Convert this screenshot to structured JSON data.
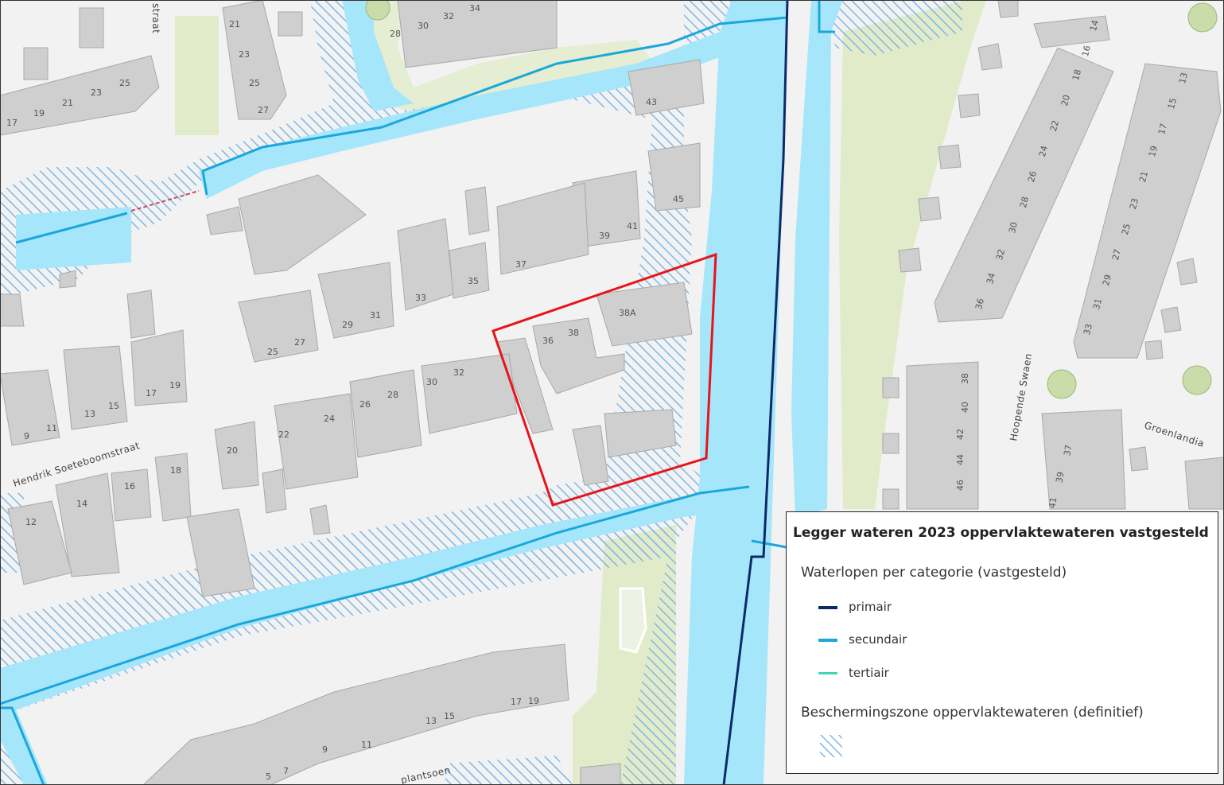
{
  "map": {
    "colors": {
      "background": "#f2f2f2",
      "water": "#a6e6fa",
      "green": "#e1ebc9",
      "building": "#cfcfcf",
      "primair": "#0c2a6b",
      "secundair": "#1aa7dc",
      "tertiair": "#3fd6b5",
      "hatch": "#7fb8e6",
      "selection": "#e8141a"
    },
    "streets": {
      "hendrik": "Hendrik Soeteboomstraat",
      "hoopende": "Hoopende Swaen",
      "groenlandia": "Groenlandia",
      "plantsoen": "plantsoen",
      "straat": "straat"
    },
    "house_numbers": {
      "n17a": "17",
      "n19a": "19",
      "n21a": "21",
      "n23a": "23",
      "n25a": "25",
      "n21b": "21",
      "n23b": "23",
      "n25b": "25",
      "n27b": "27",
      "n28t": "28",
      "n30t": "30",
      "n32t": "32",
      "n34t": "34",
      "n43": "43",
      "n45": "45",
      "n39": "39",
      "n41": "41",
      "n37": "37",
      "n35": "35",
      "n33": "33",
      "n29": "29",
      "n31": "31",
      "n25c": "25",
      "n27c": "27",
      "n36": "36",
      "n38": "38",
      "n38a": "38A",
      "n30m": "30",
      "n32m": "32",
      "n26": "26",
      "n28m": "28",
      "n24": "24",
      "n22": "22",
      "n20": "20",
      "n18": "18",
      "n16": "16",
      "n14": "14",
      "n12": "12",
      "n9": "9",
      "n11": "11",
      "n13": "13",
      "n15": "15",
      "n17b": "17",
      "n19b": "19",
      "n5": "5",
      "n7": "7",
      "n9b": "9",
      "n11b": "11",
      "n13b": "13",
      "n15b": "15",
      "n17c": "17",
      "n19c": "19",
      "e14": "14",
      "e16": "16",
      "e18": "18",
      "e20": "20",
      "e22": "22",
      "e24": "24",
      "e26": "26",
      "e28": "28",
      "e30": "30",
      "e32": "32",
      "e34": "34",
      "e36": "36",
      "e13": "13",
      "e15": "15",
      "e17": "17",
      "e19": "19",
      "e21": "21",
      "e23": "23",
      "e25": "25",
      "e27": "27",
      "e29": "29",
      "e31": "31",
      "e33": "33",
      "s38": "38",
      "s40": "40",
      "s42": "42",
      "s44": "44",
      "s46": "46",
      "s37": "37",
      "s39": "39",
      "s41": "41"
    }
  },
  "legend": {
    "title": "Legger wateren 2023 oppervlaktewateren vastgesteld",
    "category_header": "Waterlopen per categorie (vastgesteld)",
    "items": [
      {
        "label": "primair",
        "color": "#0c2a6b"
      },
      {
        "label": "secundair",
        "color": "#1aa7dc"
      },
      {
        "label": "tertiair",
        "color": "#3fd6b5"
      }
    ],
    "zone_header": "Beschermingszone oppervlaktewateren (definitief)"
  }
}
